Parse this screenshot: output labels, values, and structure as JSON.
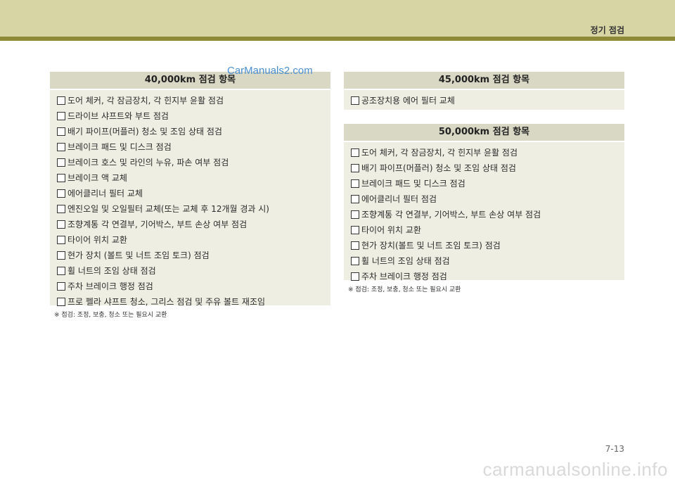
{
  "header": {
    "title": "정기 점검"
  },
  "watermark_top": "CarManuals2.com",
  "left_panel": {
    "title": "40,000km 점검 항목",
    "items": [
      "도어 체커, 각 잠금장치, 각 힌지부 윤활 점검",
      "드라이브 샤프트와 부트 점검",
      "배기 파이프(머플러) 청소 및 조임 상태 점검",
      "브레이크 패드 및 디스크 점검",
      "브레이크 호스 및 라인의 누유, 파손 여부 점검",
      "브레이크 액 교체",
      "에어클리너 필터 교체",
      "엔진오일 및 오일필터 교체(또는 교체 후 12개월 경과 시)",
      "조향계통 각 연결부, 기어박스, 부트 손상 여부 점검",
      "타이어 위치 교환",
      "현가 장치 (볼트 및 너트 조임 토크) 점검",
      "휠 너트의 조임 상태 점검",
      "주차 브레이크 행정 점검",
      "프로 펠라 샤프트 청소, 그리스 점검 및 주유 볼트 재조임"
    ],
    "note": "※ 점검: 조정, 보충, 청소 또는 필요시 교환"
  },
  "right_top_panel": {
    "title": "45,000km 점검 항목",
    "items": [
      "공조장치용 에어 필터 교체"
    ]
  },
  "right_bottom_panel": {
    "title": "50,000km 점검 항목",
    "items": [
      "도어 체커, 각 잠금장치, 각 힌지부 윤활 점검",
      "배기 파이프(머플러) 청소 및 조임 상태 점검",
      "브레이크 패드 및 디스크 점검",
      "에어클리너 필터 점검",
      "조향계통 각 연결부, 기어박스, 부트 손상 여부 점검",
      "타이어 위치 교환",
      "현가 장치(볼트 및 너트 조임 토크) 점검",
      "휠 너트의 조임 상태 점검",
      "주차 브레이크 행정 점검"
    ],
    "note": "※ 점검: 조정, 보충, 청소 또는 필요시 교환"
  },
  "page_number": "7-13",
  "watermark_bottom": "carmanualsonline.info"
}
